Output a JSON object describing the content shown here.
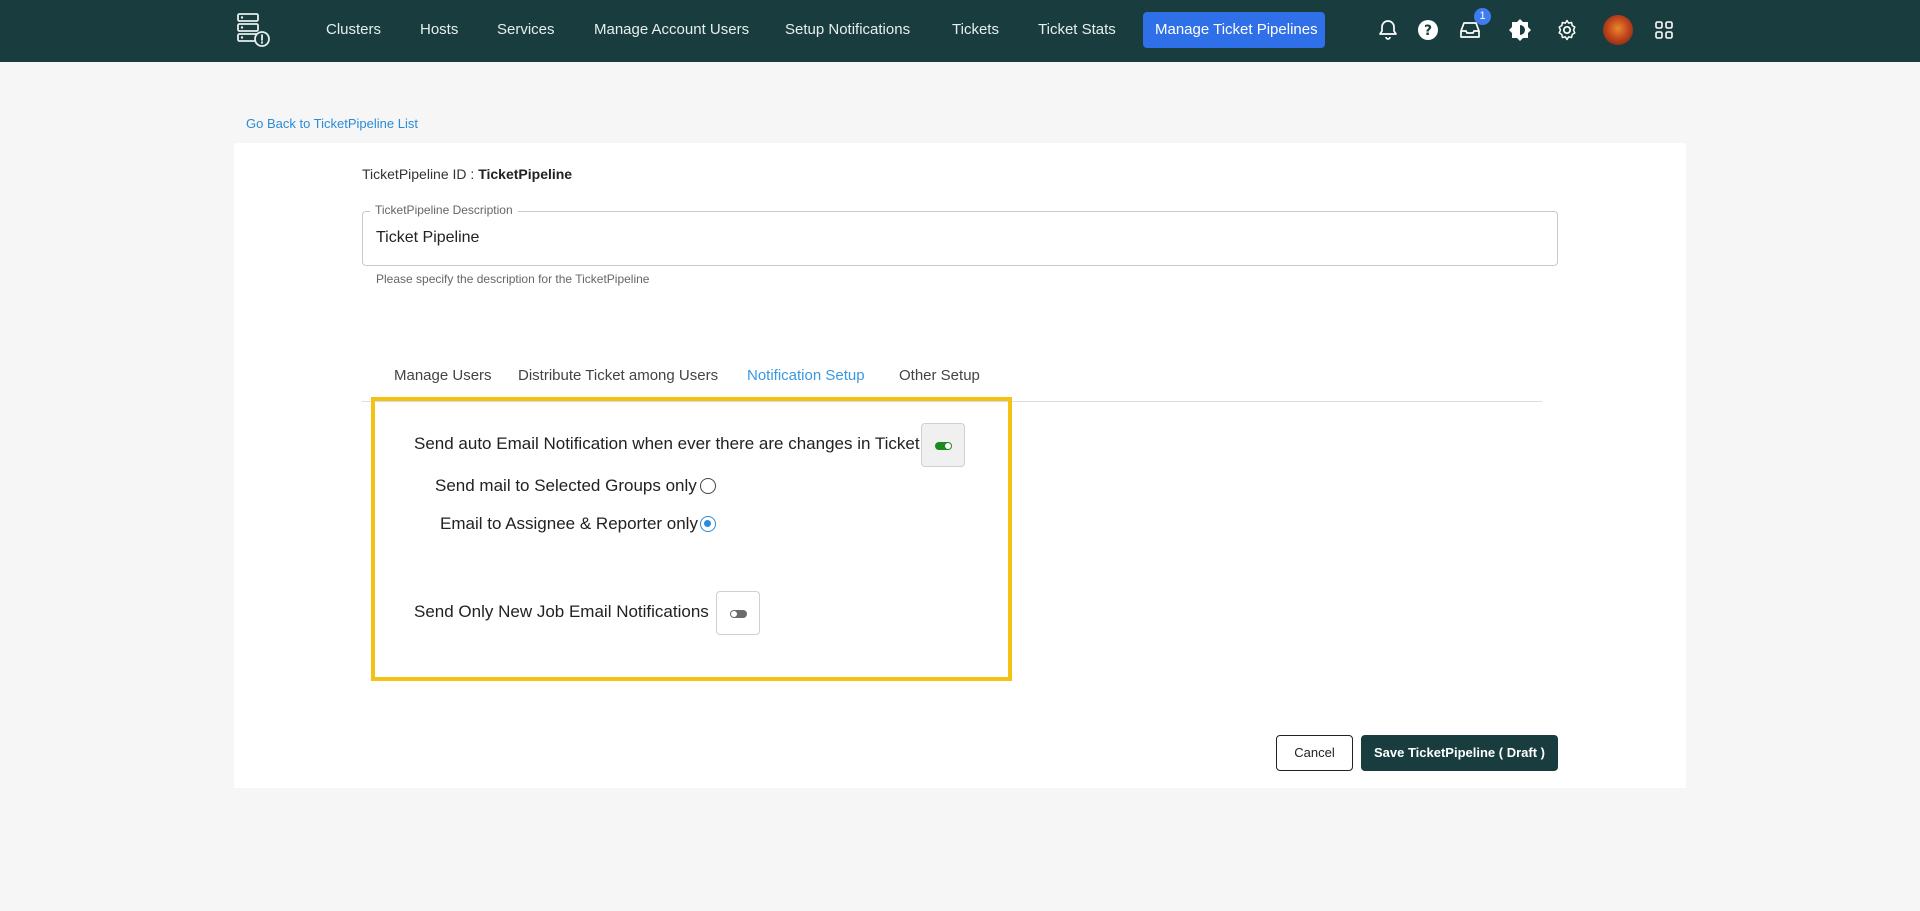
{
  "nav": {
    "items": [
      "Clusters",
      "Hosts",
      "Services",
      "Manage Account Users",
      "Setup Notifications",
      "Tickets",
      "Ticket Stats"
    ],
    "active": "Manage Ticket Pipelines",
    "inbox_badge": "1",
    "icons": [
      "bell-icon",
      "help-icon",
      "inbox-icon",
      "theme-icon",
      "gear-icon",
      "avatar",
      "apps-grid-icon"
    ]
  },
  "back_link": "Go Back to TicketPipeline List",
  "pipeline": {
    "id_label": "TicketPipeline ID : ",
    "id_value": "TicketPipeline",
    "description_label": "TicketPipeline Description",
    "description_value": "Ticket Pipeline",
    "description_helper": "Please specify the description for the TicketPipeline"
  },
  "tabs": [
    "Manage Users",
    "Distribute Ticket among Users",
    "Notification Setup",
    "Other Setup"
  ],
  "active_tab": "Notification Setup",
  "notification": {
    "auto_email_label": "Send auto Email Notification when ever there are changes in Ticket",
    "auto_email_enabled": true,
    "groups_only_label": "Send mail to Selected Groups only",
    "groups_only_selected": false,
    "assignee_reporter_label": "Email to Assignee & Reporter only",
    "assignee_reporter_selected": true,
    "new_job_label": "Send Only New Job Email Notifications",
    "new_job_enabled": false
  },
  "actions": {
    "cancel": "Cancel",
    "save": "Save TicketPipeline ( Draft )"
  },
  "colors": {
    "nav_bg": "#193d3e",
    "accent": "#2f6fe8",
    "highlight": "#f5c214",
    "toggle_on": "#1e8a1e"
  }
}
